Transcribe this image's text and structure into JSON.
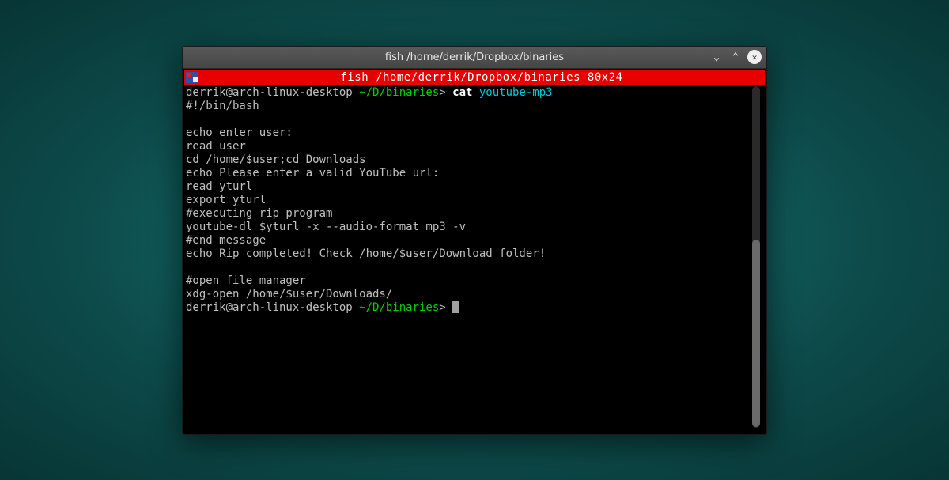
{
  "window": {
    "title": "fish /home/derrik/Dropbox/binaries"
  },
  "innerTitle": "fish  /home/derrik/Dropbox/binaries 80x24",
  "prompt1": {
    "userhost": "derrik@arch-linux-desktop",
    "path": " ~/D/binaries",
    "sep": "> ",
    "cmd": "cat",
    "arg": " youtube-mp3"
  },
  "lines": [
    "#!/bin/bash",
    "",
    "echo enter user:",
    "read user",
    "cd /home/$user;cd Downloads",
    "echo Please enter a valid YouTube url:",
    "read yturl",
    "export yturl",
    "#executing rip program",
    "youtube-dl $yturl -x --audio-format mp3 -v",
    "#end message",
    "echo Rip completed! Check /home/$user/Download folder!",
    "",
    "#open file manager",
    "xdg-open /home/$user/Downloads/"
  ],
  "prompt2": {
    "userhost": "derrik@arch-linux-desktop",
    "path": " ~/D/binaries",
    "sep": "> "
  }
}
